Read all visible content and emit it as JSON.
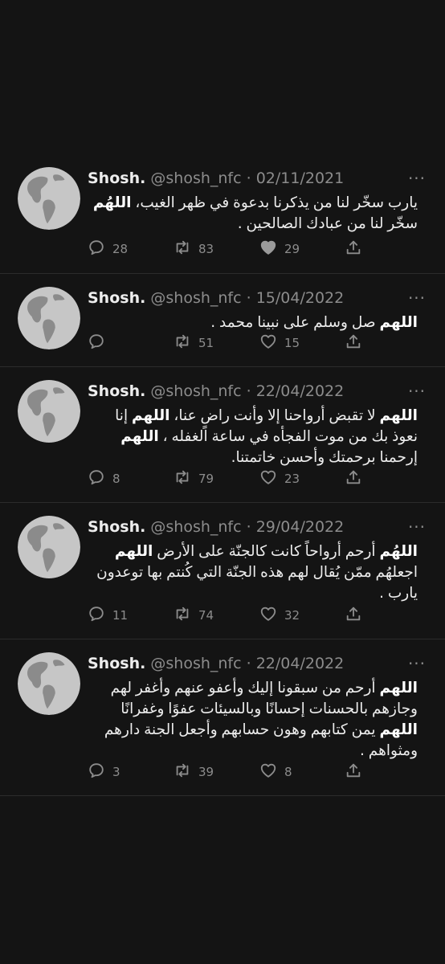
{
  "tweets": [
    {
      "name": "Shosh.",
      "handle": "@shosh_nfc",
      "separator": "·",
      "date": "02/11/2021",
      "text_parts": [
        {
          "t": "يارب سخّر لنا من يذكرنا بدعوة في ظهر الغيب، ",
          "b": false
        },
        {
          "t": "اللهُم",
          "b": true
        },
        {
          "t": " سخّر لنا من عبادك الصالحين .",
          "b": false
        }
      ],
      "replies": "28",
      "retweets": "83",
      "likes": "29",
      "liked": true,
      "more": "···"
    },
    {
      "name": "Shosh.",
      "handle": "@shosh_nfc",
      "separator": "·",
      "date": "15/04/2022",
      "text_parts": [
        {
          "t": "اللهم",
          "b": true
        },
        {
          "t": " صل وسلم على نبينا محمد .",
          "b": false
        }
      ],
      "replies": "",
      "retweets": "51",
      "likes": "15",
      "liked": false,
      "more": "···"
    },
    {
      "name": "Shosh.",
      "handle": "@shosh_nfc",
      "separator": "·",
      "date": "22/04/2022",
      "text_parts": [
        {
          "t": "اللهم",
          "b": true
        },
        {
          "t": " لا تقبض أرواحنا إلا وأنت راضٍ عنا، ",
          "b": false
        },
        {
          "t": "اللهم",
          "b": true
        },
        {
          "t": " إنا نعوذ بك من موت الفجأه في ساعة الغفله ، ",
          "b": false
        },
        {
          "t": "اللهم",
          "b": true
        },
        {
          "t": " إرحمنا برحمتك وأحسن خاتمتنا.",
          "b": false
        }
      ],
      "replies": "8",
      "retweets": "79",
      "likes": "23",
      "liked": false,
      "more": "···"
    },
    {
      "name": "Shosh.",
      "handle": "@shosh_nfc",
      "separator": "·",
      "date": "29/04/2022",
      "text_parts": [
        {
          "t": "اللهُم",
          "b": true
        },
        {
          "t": "  أرحم أرواحاً كانت كالجنّة على الأرض ",
          "b": false
        },
        {
          "t": "اللهم",
          "b": true
        },
        {
          "t": " اجعلهُم ممّن يُقال لهم هذه الجنّة التي كُنتم بها توعدون يارب .",
          "b": false
        }
      ],
      "replies": "11",
      "retweets": "74",
      "likes": "32",
      "liked": false,
      "more": "···"
    },
    {
      "name": "Shosh.",
      "handle": "@shosh_nfc",
      "separator": "·",
      "date": "22/04/2022",
      "text_parts": [
        {
          "t": "اللهم",
          "b": true
        },
        {
          "t": " أرحم من سبقونا إليك وأعفو عنهم وأغفر لهم وجازهم بالحسنات إحسانًا وبالسيئات عفوًا وغفرانًا ",
          "b": false
        },
        {
          "t": "اللهم",
          "b": true
        },
        {
          "t": " يمن كتابهم وهون حسابهم وأجعل الجنة دارهم ومثواهم .",
          "b": false
        }
      ],
      "replies": "3",
      "retweets": "39",
      "likes": "8",
      "liked": false,
      "more": "···"
    }
  ],
  "icons": {
    "avatar": "globe-icon",
    "reply": "reply-icon",
    "retweet": "retweet-icon",
    "like": "heart-icon",
    "share": "share-icon",
    "more": "more-icon"
  },
  "colors": {
    "background": "#141414",
    "text": "#ececec",
    "muted": "#8c8c8c",
    "divider": "#2c2c2c",
    "avatar_bg": "#c6c6c6",
    "avatar_land": "#8b8b8b"
  }
}
